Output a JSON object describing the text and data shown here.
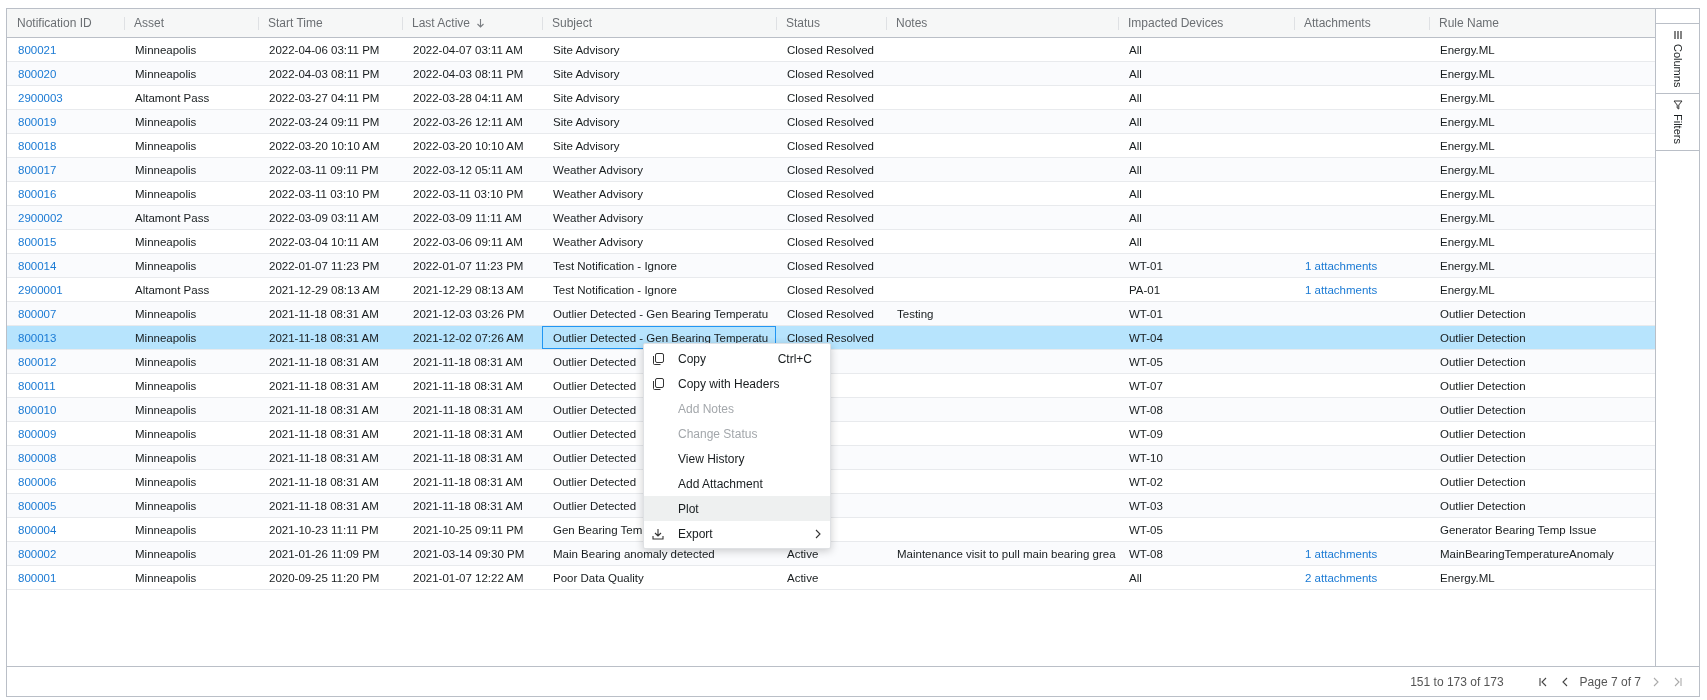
{
  "table": {
    "columns": [
      {
        "label": "Notification ID",
        "kind": "link",
        "sorted": false
      },
      {
        "label": "Asset",
        "kind": "text",
        "sorted": false
      },
      {
        "label": "Start Time",
        "kind": "text",
        "sorted": false
      },
      {
        "label": "Last Active",
        "kind": "text",
        "sorted": true
      },
      {
        "label": "Subject",
        "kind": "text",
        "sorted": false
      },
      {
        "label": "Status",
        "kind": "text",
        "sorted": false
      },
      {
        "label": "Notes",
        "kind": "text",
        "sorted": false
      },
      {
        "label": "Impacted Devices",
        "kind": "text",
        "sorted": false
      },
      {
        "label": "Attachments",
        "kind": "link",
        "sorted": false
      },
      {
        "label": "Rule Name",
        "kind": "text",
        "sorted": false
      }
    ],
    "rows": [
      {
        "cells": [
          "800021",
          "Minneapolis",
          "2022-04-06 03:11 PM",
          "2022-04-07 03:11 AM",
          "Site Advisory",
          "Closed Resolved",
          null,
          "All",
          null,
          "Energy.ML"
        ],
        "selected": false,
        "focused": false
      },
      {
        "cells": [
          "800020",
          "Minneapolis",
          "2022-04-03 08:11 PM",
          "2022-04-03 08:11 PM",
          "Site Advisory",
          "Closed Resolved",
          null,
          "All",
          null,
          "Energy.ML"
        ],
        "selected": false,
        "focused": false
      },
      {
        "cells": [
          "2900003",
          "Altamont Pass",
          "2022-03-27 04:11 PM",
          "2022-03-28 04:11 AM",
          "Site Advisory",
          "Closed Resolved",
          null,
          "All",
          null,
          "Energy.ML"
        ],
        "selected": false,
        "focused": false
      },
      {
        "cells": [
          "800019",
          "Minneapolis",
          "2022-03-24 09:11 PM",
          "2022-03-26 12:11 AM",
          "Site Advisory",
          "Closed Resolved",
          null,
          "All",
          null,
          "Energy.ML"
        ],
        "selected": false,
        "focused": false
      },
      {
        "cells": [
          "800018",
          "Minneapolis",
          "2022-03-20 10:10 AM",
          "2022-03-20 10:10 AM",
          "Site Advisory",
          "Closed Resolved",
          null,
          "All",
          null,
          "Energy.ML"
        ],
        "selected": false,
        "focused": false
      },
      {
        "cells": [
          "800017",
          "Minneapolis",
          "2022-03-11 09:11 PM",
          "2022-03-12 05:11 AM",
          "Weather Advisory",
          "Closed Resolved",
          null,
          "All",
          null,
          "Energy.ML"
        ],
        "selected": false,
        "focused": false
      },
      {
        "cells": [
          "800016",
          "Minneapolis",
          "2022-03-11 03:10 PM",
          "2022-03-11 03:10 PM",
          "Weather Advisory",
          "Closed Resolved",
          null,
          "All",
          null,
          "Energy.ML"
        ],
        "selected": false,
        "focused": false
      },
      {
        "cells": [
          "2900002",
          "Altamont Pass",
          "2022-03-09 03:11 AM",
          "2022-03-09 11:11 AM",
          "Weather Advisory",
          "Closed Resolved",
          null,
          "All",
          null,
          "Energy.ML"
        ],
        "selected": false,
        "focused": false
      },
      {
        "cells": [
          "800015",
          "Minneapolis",
          "2022-03-04 10:11 AM",
          "2022-03-06 09:11 AM",
          "Weather Advisory",
          "Closed Resolved",
          null,
          "All",
          null,
          "Energy.ML"
        ],
        "selected": false,
        "focused": false
      },
      {
        "cells": [
          "800014",
          "Minneapolis",
          "2022-01-07 11:23 PM",
          "2022-01-07 11:23 PM",
          "Test Notification - Ignore",
          "Closed Resolved",
          null,
          "WT-01",
          "1 attachments",
          "Energy.ML"
        ],
        "selected": false,
        "focused": false
      },
      {
        "cells": [
          "2900001",
          "Altamont Pass",
          "2021-12-29 08:13 AM",
          "2021-12-29 08:13 AM",
          "Test Notification - Ignore",
          "Closed Resolved",
          null,
          "PA-01",
          "1 attachments",
          "Energy.ML"
        ],
        "selected": false,
        "focused": false
      },
      {
        "cells": [
          "800007",
          "Minneapolis",
          "2021-11-18 08:31 AM",
          "2021-12-03 03:26 PM",
          "Outlier Detected - Gen Bearing Temperatu",
          "Closed Resolved",
          "Testing",
          "WT-01",
          null,
          "Outlier Detection"
        ],
        "selected": false,
        "focused": false
      },
      {
        "cells": [
          "800013",
          "Minneapolis",
          "2021-11-18 08:31 AM",
          "2021-12-02 07:26 AM",
          "Outlier Detected - Gen Bearing Temperatu",
          "Closed Resolved",
          null,
          "WT-04",
          null,
          "Outlier Detection"
        ],
        "selected": true,
        "focused": true
      },
      {
        "cells": [
          "800012",
          "Minneapolis",
          "2021-11-18 08:31 AM",
          "2021-11-18 08:31 AM",
          "Outlier Detected",
          null,
          null,
          "WT-05",
          null,
          "Outlier Detection"
        ],
        "selected": false,
        "focused": false
      },
      {
        "cells": [
          "800011",
          "Minneapolis",
          "2021-11-18 08:31 AM",
          "2021-11-18 08:31 AM",
          "Outlier Detected",
          null,
          null,
          "WT-07",
          null,
          "Outlier Detection"
        ],
        "selected": false,
        "focused": false
      },
      {
        "cells": [
          "800010",
          "Minneapolis",
          "2021-11-18 08:31 AM",
          "2021-11-18 08:31 AM",
          "Outlier Detected",
          null,
          null,
          "WT-08",
          null,
          "Outlier Detection"
        ],
        "selected": false,
        "focused": false
      },
      {
        "cells": [
          "800009",
          "Minneapolis",
          "2021-11-18 08:31 AM",
          "2021-11-18 08:31 AM",
          "Outlier Detected",
          null,
          null,
          "WT-09",
          null,
          "Outlier Detection"
        ],
        "selected": false,
        "focused": false
      },
      {
        "cells": [
          "800008",
          "Minneapolis",
          "2021-11-18 08:31 AM",
          "2021-11-18 08:31 AM",
          "Outlier Detected",
          null,
          null,
          "WT-10",
          null,
          "Outlier Detection"
        ],
        "selected": false,
        "focused": false
      },
      {
        "cells": [
          "800006",
          "Minneapolis",
          "2021-11-18 08:31 AM",
          "2021-11-18 08:31 AM",
          "Outlier Detected",
          null,
          null,
          "WT-02",
          null,
          "Outlier Detection"
        ],
        "selected": false,
        "focused": false
      },
      {
        "cells": [
          "800005",
          "Minneapolis",
          "2021-11-18 08:31 AM",
          "2021-11-18 08:31 AM",
          "Outlier Detected",
          null,
          null,
          "WT-03",
          null,
          "Outlier Detection"
        ],
        "selected": false,
        "focused": false
      },
      {
        "cells": [
          "800004",
          "Minneapolis",
          "2021-10-23 11:11 PM",
          "2021-10-25 09:11 PM",
          "Gen Bearing Tem",
          null,
          null,
          "WT-05",
          null,
          "Generator Bearing Temp Issue"
        ],
        "selected": false,
        "focused": false
      },
      {
        "cells": [
          "800002",
          "Minneapolis",
          "2021-01-26 11:09 PM",
          "2021-03-14 09:30 PM",
          "Main Bearing anomaly detected",
          "Active",
          "Maintenance visit to pull main bearing grea",
          "WT-08",
          "1 attachments",
          "MainBearingTemperatureAnomaly"
        ],
        "selected": false,
        "focused": false
      },
      {
        "cells": [
          "800001",
          "Minneapolis",
          "2020-09-25 11:20 PM",
          "2021-01-07 12:22 AM",
          "Poor Data Quality",
          "Active",
          null,
          "All",
          "2 attachments",
          "Energy.ML"
        ],
        "selected": false,
        "focused": false
      }
    ]
  },
  "context_menu": {
    "items": [
      {
        "label": "Copy",
        "kind": "copy",
        "shortcut": "Ctrl+C",
        "disabled": false,
        "highlighted": false,
        "submenu": false
      },
      {
        "label": "Copy with Headers",
        "kind": "copy",
        "disabled": false,
        "highlighted": false,
        "submenu": false
      },
      {
        "label": "Add Notes",
        "kind": "plain",
        "disabled": true,
        "highlighted": false,
        "submenu": false
      },
      {
        "label": "Change Status",
        "kind": "plain",
        "disabled": true,
        "highlighted": false,
        "submenu": false
      },
      {
        "label": "View History",
        "kind": "plain",
        "disabled": false,
        "highlighted": false,
        "submenu": false
      },
      {
        "label": "Add Attachment",
        "kind": "plain",
        "disabled": false,
        "highlighted": false,
        "submenu": false
      },
      {
        "label": "Plot",
        "kind": "plain",
        "disabled": false,
        "highlighted": true,
        "submenu": false
      },
      {
        "label": "Export",
        "kind": "download",
        "disabled": false,
        "highlighted": false,
        "submenu": true
      }
    ]
  },
  "side_bar": {
    "tabs": [
      {
        "label": "Columns",
        "kind": "columns"
      },
      {
        "label": "Filters",
        "kind": "filter"
      }
    ]
  },
  "pagination": {
    "summary": "151 to 173 of 173",
    "page": "Page 7 of 7",
    "buttons": [
      {
        "kind": "first",
        "disabled": false
      },
      {
        "kind": "prev",
        "disabled": false
      },
      {
        "kind": "next",
        "disabled": true
      },
      {
        "kind": "last",
        "disabled": true
      }
    ]
  }
}
